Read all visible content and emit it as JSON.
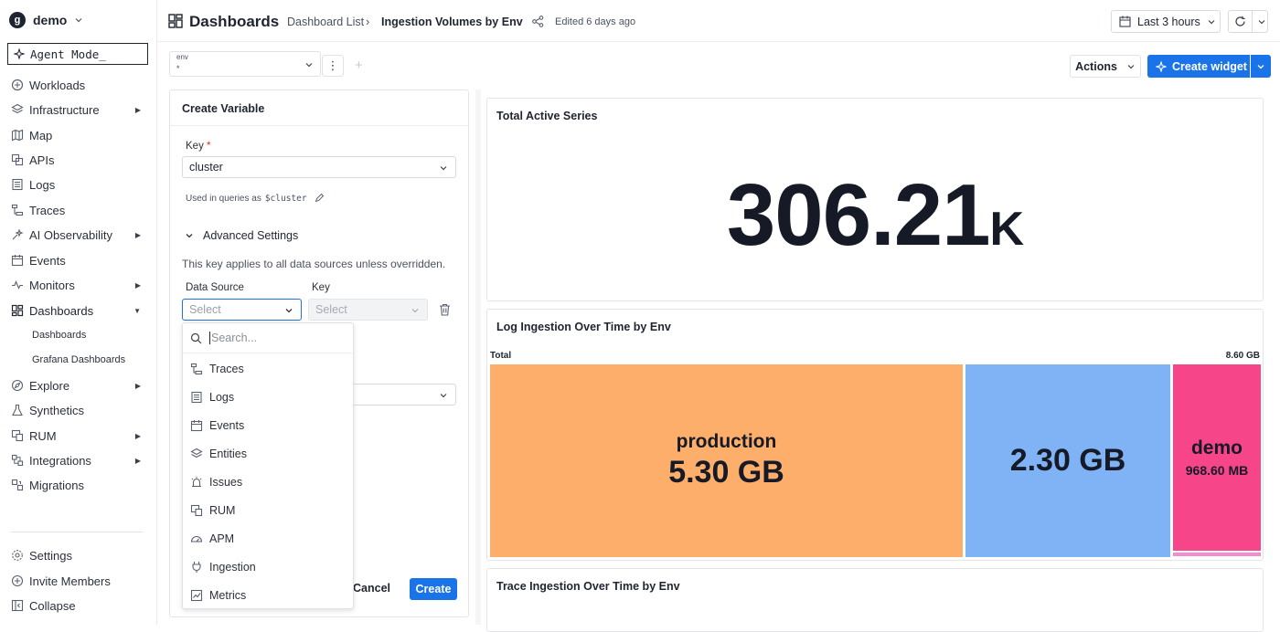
{
  "sidebar": {
    "org": "demo",
    "agent_mode": "Agent Mode_",
    "items": [
      {
        "label": "Workloads"
      },
      {
        "label": "Infrastructure"
      },
      {
        "label": "Map"
      },
      {
        "label": "APIs"
      },
      {
        "label": "Logs"
      },
      {
        "label": "Traces"
      },
      {
        "label": "AI Observability"
      },
      {
        "label": "Events"
      },
      {
        "label": "Monitors"
      },
      {
        "label": "Dashboards"
      },
      {
        "label": "Explore"
      },
      {
        "label": "Synthetics"
      },
      {
        "label": "RUM"
      },
      {
        "label": "Integrations"
      },
      {
        "label": "Migrations"
      }
    ],
    "subitems": [
      "Dashboards",
      "Grafana Dashboards"
    ],
    "bottom": [
      "Settings",
      "Invite Members",
      "Collapse"
    ]
  },
  "header": {
    "title": "Dashboards",
    "breadcrumb_list": "Dashboard List",
    "breadcrumb_sep": "›",
    "breadcrumb_current": "Ingestion Volumes by Env",
    "edited": "Edited 6 days ago",
    "time_range": "Last 3 hours"
  },
  "variables": {
    "env_key": "env",
    "env_value": "*",
    "actions": "Actions",
    "create_widget": "Create widget"
  },
  "create_variable": {
    "title": "Create Variable",
    "key_label": "Key",
    "required_mark": "*",
    "key_value": "cluster",
    "used_in": "Used in queries as",
    "used_code": "$cluster",
    "advanced": "Advanced Settings",
    "advanced_desc": "This key applies to all data sources unless overridden.",
    "ds_label": "Data Source",
    "ds_placeholder": "Select",
    "key2_label": "Key",
    "key2_placeholder": "Select",
    "cancel": "Cancel",
    "create": "Create"
  },
  "dropdown": {
    "search_placeholder": "Search...",
    "options": [
      "Traces",
      "Logs",
      "Events",
      "Entities",
      "Issues",
      "RUM",
      "APM",
      "Ingestion",
      "Metrics"
    ]
  },
  "widgets": {
    "active_series": {
      "title": "Total Active Series",
      "value": "306.21",
      "suffix": "K"
    },
    "log_ingestion": {
      "title": "Log Ingestion Over Time by Env",
      "total_label": "Total",
      "total_value": "8.60 GB",
      "tiles": [
        {
          "name": "production",
          "value": "5.30 GB",
          "color": "#fdae6b"
        },
        {
          "name": "",
          "value": "2.30 GB",
          "color": "#7fb3f5"
        },
        {
          "name": "demo",
          "value": "968.60 MB",
          "color": "#f7458a"
        }
      ]
    },
    "trace_ingestion": {
      "title": "Trace Ingestion Over Time by Env"
    }
  }
}
